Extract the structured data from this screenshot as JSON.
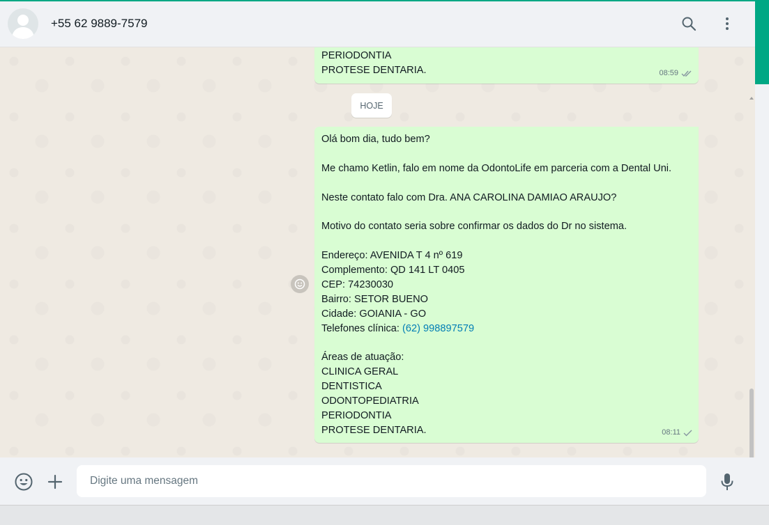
{
  "header": {
    "contact_name": "+55 62 9889-7579",
    "avatar_icon": "default-avatar-icon",
    "search_icon": "search-icon",
    "menu_icon": "kebab-menu-icon"
  },
  "chat": {
    "previous_message": {
      "lines": [
        "PERIODONTIA",
        "PROTESE DENTARIA."
      ],
      "time": "08:59",
      "status_icon": "double-check-icon"
    },
    "day_divider": "HOJE",
    "message": {
      "lines": [
        "Olá bom dia, tudo bem?",
        "",
        "Me chamo Ketlin, falo em nome da OdontoLife em parceria com a Dental Uni.",
        "",
        "Neste contato falo com Dra. ANA CAROLINA DAMIAO ARAUJO?",
        "",
        "Motivo do contato seria sobre confirmar os dados do Dr no sistema.",
        "",
        "Endereço: AVENIDA T 4 nº 619",
        "Complemento: QD 141 LT 0405",
        "CEP: 74230030",
        "Bairro: SETOR BUENO",
        "Cidade: GOIANIA - GO"
      ],
      "phone_label": "Telefones clínica: ",
      "phone_link": "(62) 998897579",
      "lines_after": [
        "",
        "Áreas de atuação:",
        "CLINICA GERAL",
        "DENTISTICA",
        "ODONTOPEDIATRIA",
        "PERIODONTIA",
        "PROTESE DENTARIA."
      ],
      "time": "08:11",
      "status_icon": "single-check-icon"
    },
    "react_icon": "emoji-react-icon"
  },
  "composer": {
    "placeholder": "Digite uma mensagem",
    "value": "",
    "emoji_icon": "emoji-icon",
    "attach_icon": "plus-icon",
    "mic_icon": "microphone-icon"
  },
  "colors": {
    "accent": "#00a884",
    "outgoing_bubble": "#d9fdd3",
    "link": "#027eb5",
    "chat_bg": "#efeae2"
  }
}
